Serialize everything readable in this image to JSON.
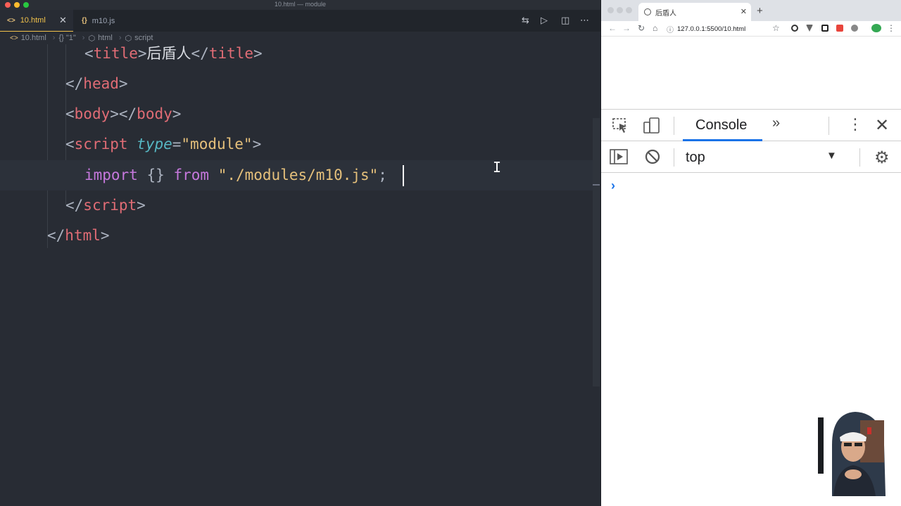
{
  "window": {
    "title": "10.html — module"
  },
  "tabs": [
    {
      "icon": "<>",
      "label": "10.html"
    },
    {
      "icon": "{}",
      "label": "m10.js"
    }
  ],
  "breadcrumb": [
    "10.html",
    "{} \"1\"",
    "html",
    "script"
  ],
  "code": {
    "line1": {
      "open_lt": "<",
      "open_tag": "title",
      "open_gt": ">",
      "text": "后盾人",
      "close_lt": "</",
      "close_tag": "title",
      "close_gt": ">"
    },
    "line2": {
      "lt": "</",
      "tag": "head",
      "gt": ">"
    },
    "line3": {
      "open_lt": "<",
      "open_tag": "body",
      "mid": "></",
      "close_tag": "body",
      "close_gt": ">"
    },
    "line4": {
      "lt": "<",
      "tag": "script",
      "attr": "type",
      "eq": "=",
      "val": "\"module\"",
      "gt": ">"
    },
    "line5": {
      "kw_import": "import",
      "braces": "{}",
      "kw_from": "from",
      "path": "\"./modules/m10.js\"",
      "semi": ";"
    },
    "line6": {
      "lt": "</",
      "tag": "script",
      "gt": ">"
    },
    "line7": {
      "lt": "</",
      "tag": "html",
      "gt": ">"
    }
  },
  "browser": {
    "tab_title": "后盾人",
    "url": "127.0.0.1:5500/10.html",
    "devtools": {
      "console_tab": "Console",
      "context": "top",
      "prompt": "›"
    }
  },
  "colors": {
    "editor_bg": "#282c34",
    "tag": "#e06c75",
    "attr": "#56b6c2",
    "string": "#e5c07b",
    "keyword": "#c678dd",
    "accent": "#1a73e8"
  }
}
